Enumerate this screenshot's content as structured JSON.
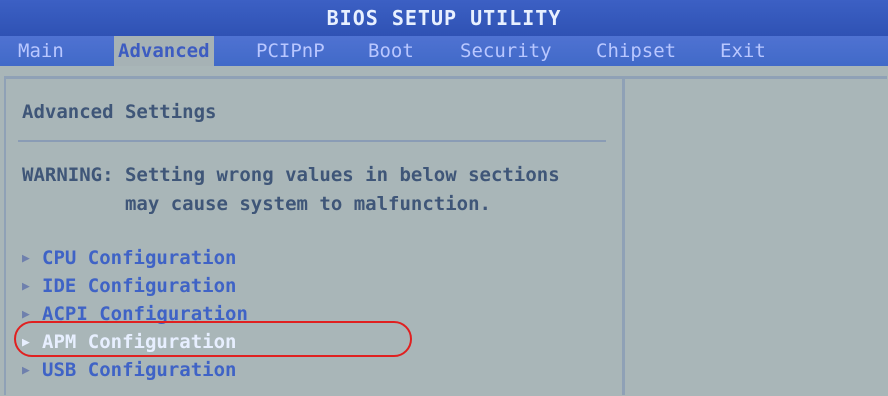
{
  "header": {
    "title": "BIOS SETUP UTILITY"
  },
  "menu": [
    {
      "label": "Main"
    },
    {
      "label": "Advanced"
    },
    {
      "label": "PCIPnP"
    },
    {
      "label": "Boot"
    },
    {
      "label": "Security"
    },
    {
      "label": "Chipset"
    },
    {
      "label": "Exit"
    }
  ],
  "main": {
    "title": "Advanced Settings",
    "warning": "WARNING: Setting wrong values in below sections\n         may cause system to malfunction.",
    "items": [
      {
        "label": "CPU Configuration"
      },
      {
        "label": "IDE Configuration"
      },
      {
        "label": "ACPI Configuration"
      },
      {
        "label": "APM Configuration"
      },
      {
        "label": "USB Configuration"
      }
    ],
    "arrow_icon": "right-triangle-icon"
  },
  "annotation": {
    "color": "#e02020"
  }
}
